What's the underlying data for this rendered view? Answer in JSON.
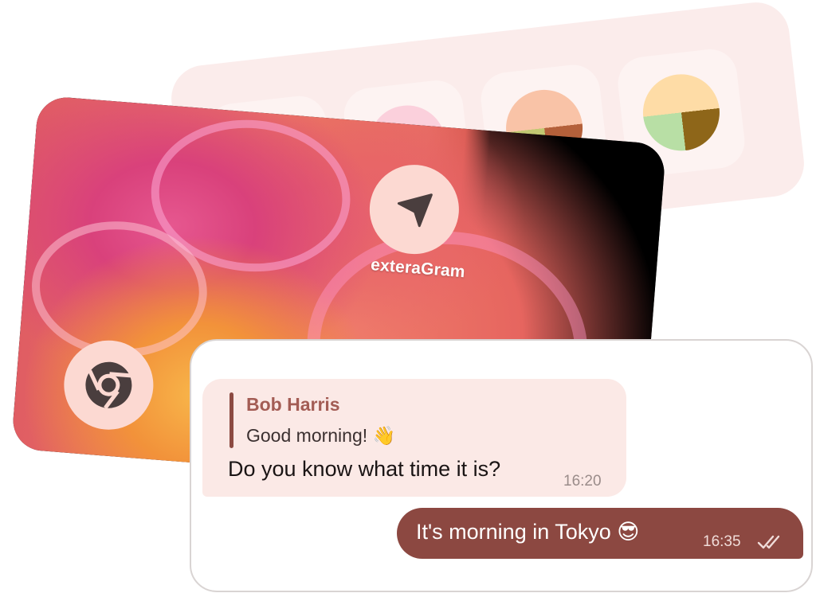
{
  "launcher": {
    "app_name": "exteraGram",
    "icons": [
      "send-icon",
      "chrome-icon"
    ]
  },
  "palette": {
    "swatches": [
      {
        "colors": [
          "#fde3e3",
          "#fbd3d3"
        ]
      },
      {
        "colors": [
          "#fbd0dc",
          "#f7b8c8"
        ]
      },
      {
        "colors": [
          "#f9c3a7",
          "#c2c872",
          "#b4603a"
        ]
      },
      {
        "colors": [
          "#fedca6",
          "#b8dfa5",
          "#8e6619"
        ]
      }
    ]
  },
  "chat": {
    "incoming": {
      "reply_author": "Bob Harris",
      "reply_text": "Good morning! 👋",
      "text": "Do you know what time it is?",
      "time": "16:20"
    },
    "outgoing": {
      "text": "It's morning in Tokyo 😎",
      "time": "16:35",
      "status": "read"
    }
  },
  "colors": {
    "accent": "#8c4841",
    "bubble_in": "#fbe9e6",
    "icon_bg": "#fcd9d2"
  }
}
